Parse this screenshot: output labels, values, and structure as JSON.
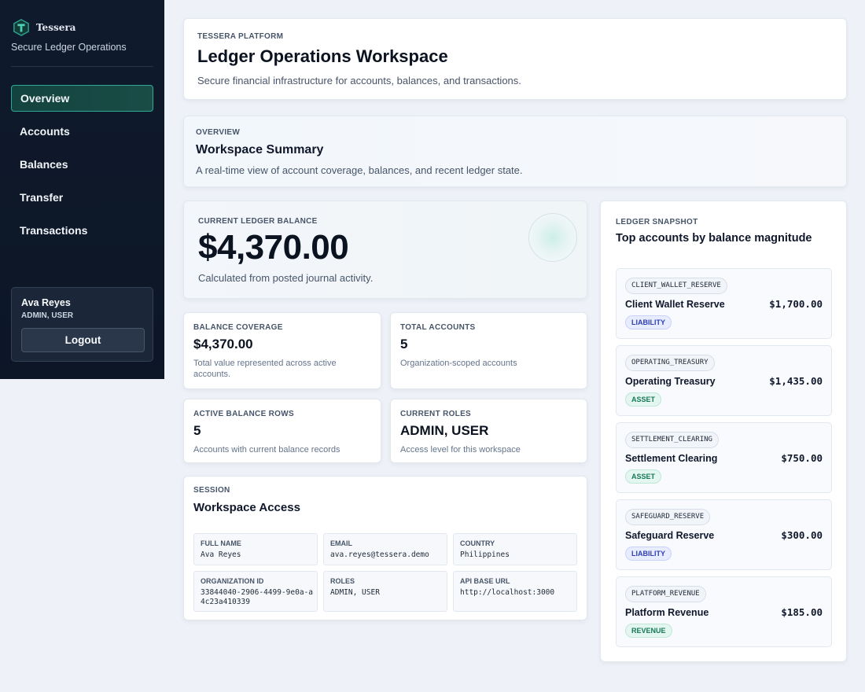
{
  "sidebar": {
    "brand_name": "Tessera",
    "brand_tagline": "Secure Ledger Operations",
    "logo_icon": "tessera-logo-icon",
    "nav": [
      {
        "label": "Overview",
        "active": true
      },
      {
        "label": "Accounts",
        "active": false
      },
      {
        "label": "Balances",
        "active": false
      },
      {
        "label": "Transfer",
        "active": false
      },
      {
        "label": "Transactions",
        "active": false
      }
    ],
    "user": {
      "name": "Ava Reyes",
      "roles": "ADMIN, USER",
      "logout_label": "Logout"
    }
  },
  "header": {
    "eyebrow": "TESSERA PLATFORM",
    "title": "Ledger Operations Workspace",
    "subtitle": "Secure financial infrastructure for accounts, balances, and transactions."
  },
  "overview": {
    "eyebrow": "OVERVIEW",
    "title": "Workspace Summary",
    "subtitle": "A real-time view of account coverage, balances, and recent ledger state."
  },
  "balance": {
    "eyebrow": "CURRENT LEDGER BALANCE",
    "value": "$4,370.00",
    "subtitle": "Calculated from posted journal activity."
  },
  "stats": [
    {
      "label": "BALANCE COVERAGE",
      "value": "$4,370.00",
      "desc": "Total value represented across active accounts."
    },
    {
      "label": "TOTAL ACCOUNTS",
      "value": "5",
      "desc": "Organization-scoped accounts"
    },
    {
      "label": "ACTIVE BALANCE ROWS",
      "value": "5",
      "desc": "Accounts with current balance records"
    },
    {
      "label": "CURRENT ROLES",
      "value": "ADMIN, USER",
      "desc": "Access level for this workspace"
    }
  ],
  "session": {
    "eyebrow": "SESSION",
    "title": "Workspace Access",
    "fields": [
      {
        "label": "FULL NAME",
        "value": "Ava Reyes"
      },
      {
        "label": "EMAIL",
        "value": "ava.reyes@tessera.demo"
      },
      {
        "label": "COUNTRY",
        "value": "Philippines"
      },
      {
        "label": "ORGANIZATION ID",
        "value": "33844040-2906-4499-9e0a-a4c23a410339"
      },
      {
        "label": "ROLES",
        "value": "ADMIN, USER"
      },
      {
        "label": "API BASE URL",
        "value": "http://localhost:3000"
      }
    ]
  },
  "snapshot": {
    "eyebrow": "LEDGER SNAPSHOT",
    "title": "Top accounts by balance magnitude",
    "accounts": [
      {
        "code": "CLIENT_WALLET_RESERVE",
        "name": "Client Wallet Reserve",
        "amount": "$1,700.00",
        "type": "LIABILITY"
      },
      {
        "code": "OPERATING_TREASURY",
        "name": "Operating Treasury",
        "amount": "$1,435.00",
        "type": "ASSET"
      },
      {
        "code": "SETTLEMENT_CLEARING",
        "name": "Settlement Clearing",
        "amount": "$750.00",
        "type": "ASSET"
      },
      {
        "code": "SAFEGUARD_RESERVE",
        "name": "Safeguard Reserve",
        "amount": "$300.00",
        "type": "LIABILITY"
      },
      {
        "code": "PLATFORM_REVENUE",
        "name": "Platform Revenue",
        "amount": "$185.00",
        "type": "REVENUE"
      }
    ]
  },
  "colors": {
    "sidebar_bg": "#0f1a2c",
    "accent_teal": "#2fa895",
    "page_bg": "#eef1f8",
    "badge_liability": "#3040b0",
    "badge_asset": "#17785a"
  }
}
